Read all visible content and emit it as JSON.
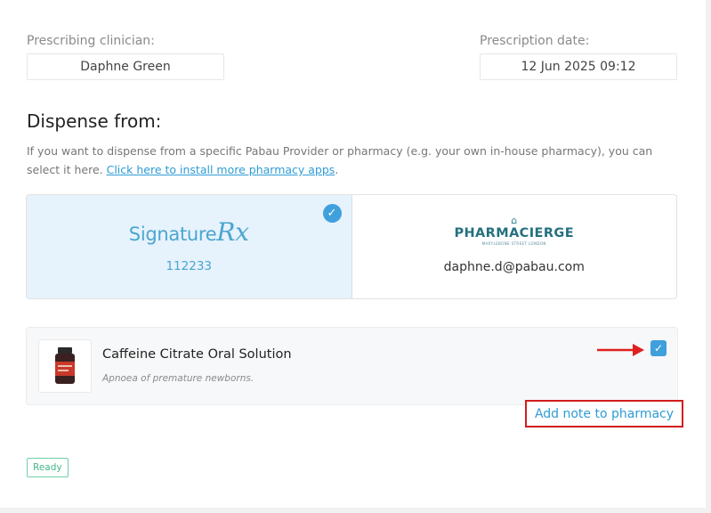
{
  "clinician": {
    "label": "Prescribing clinician:",
    "value": "Daphne Green"
  },
  "date": {
    "label": "Prescription date:",
    "value": "12 Jun 2025 09:12"
  },
  "dispense": {
    "title": "Dispense from:",
    "helper_text": "If you want to dispense from a specific Pabau Provider or pharmacy (e.g. your own in-house pharmacy), you can select it here.",
    "install_link": "Click here to install more pharmacy apps",
    "link_suffix": "."
  },
  "providers": [
    {
      "logo_text": "Signature",
      "logo_rx": "Rx",
      "detail": "112233",
      "selected": true
    },
    {
      "logo_text": "PHARMACIERGE",
      "logo_tag": "MARYLEBONE STREET LONDON",
      "detail": "daphne.d@pabau.com",
      "selected": false
    }
  ],
  "product": {
    "name": "Caffeine Citrate Oral Solution",
    "description": "Apnoea of premature newborns.",
    "checked": true
  },
  "note_link": "Add note to pharmacy",
  "status": "Ready",
  "colors": {
    "accent": "#3fa0dc",
    "highlight": "#d21d1d",
    "ready": "#45b888",
    "selected_bg": "#e6f2fc"
  },
  "icons": {
    "provider_check": "check-circle-icon",
    "product_check": "checkbox-checked-icon",
    "arrow": "arrow-right-icon"
  }
}
